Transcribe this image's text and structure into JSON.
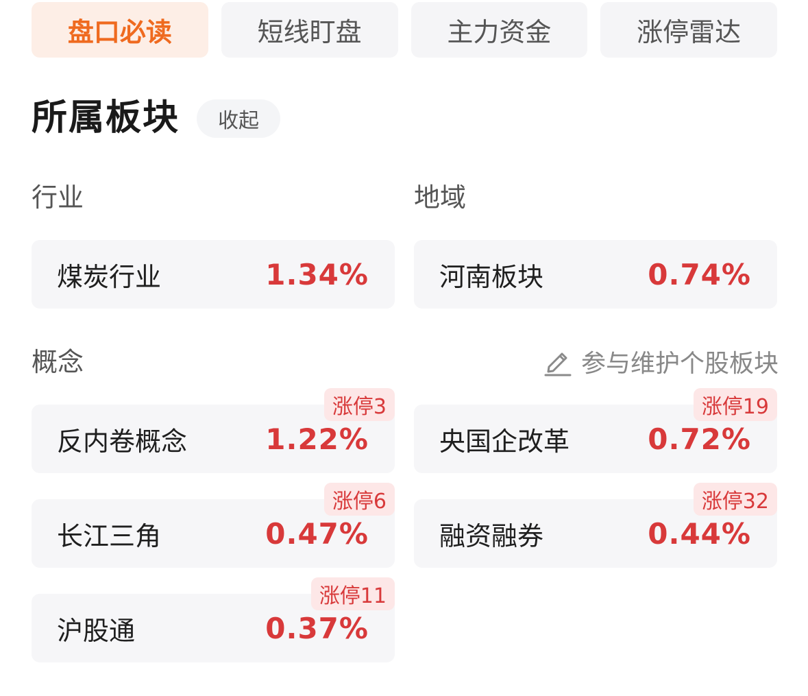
{
  "tabs": [
    {
      "label": "盘口必读",
      "active": true
    },
    {
      "label": "短线盯盘",
      "active": false
    },
    {
      "label": "主力资金",
      "active": false
    },
    {
      "label": "涨停雷达",
      "active": false
    }
  ],
  "section": {
    "title": "所属板块",
    "collapse_label": "收起"
  },
  "industry": {
    "label": "行业",
    "items": [
      {
        "name": "煤炭行业",
        "pct": "1.34%"
      }
    ]
  },
  "region": {
    "label": "地域",
    "items": [
      {
        "name": "河南板块",
        "pct": "0.74%"
      }
    ]
  },
  "concept": {
    "label": "概念",
    "maintain_label": "参与维护个股板块",
    "maintain_icon": "edit-pencil-icon",
    "items": [
      {
        "name": "反内卷概念",
        "pct": "1.22%",
        "badge": "涨停3"
      },
      {
        "name": "央国企改革",
        "pct": "0.72%",
        "badge": "涨停19"
      },
      {
        "name": "长江三角",
        "pct": "0.47%",
        "badge": "涨停6"
      },
      {
        "name": "融资融券",
        "pct": "0.44%",
        "badge": "涨停32"
      },
      {
        "name": "沪股通",
        "pct": "0.37%",
        "badge": "涨停11"
      }
    ]
  },
  "colors": {
    "accent": "#ef6a1f",
    "up": "#d8393a",
    "badge_bg": "#fde7e7",
    "card_bg": "#f6f6f8"
  }
}
